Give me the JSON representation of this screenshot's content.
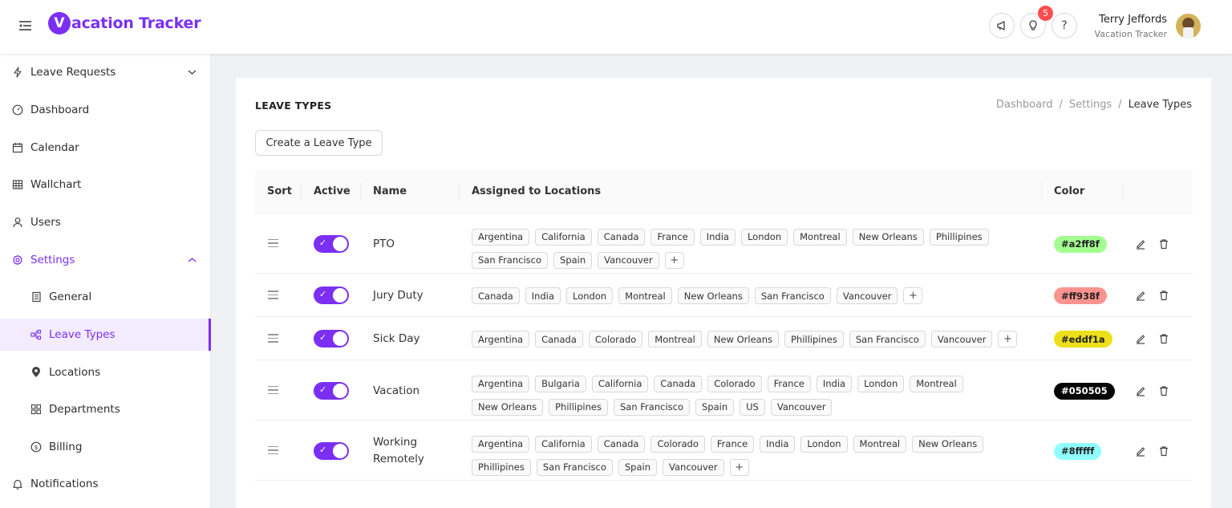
{
  "app": {
    "name": "Vacation Tracker",
    "logo_letter": "V",
    "logo_rest": "acation Tracker",
    "brand_color": "#7b2ff2"
  },
  "header": {
    "notifications_count": "5",
    "user_name": "Terry Jeffords",
    "user_company": "Vacation Tracker",
    "help_icon": "?"
  },
  "sidebar": {
    "items": [
      {
        "label": "Leave Requests",
        "icon": "bolt-icon"
      },
      {
        "label": "Dashboard",
        "icon": "gauge-icon"
      },
      {
        "label": "Calendar",
        "icon": "calendar-icon"
      },
      {
        "label": "Wallchart",
        "icon": "table-icon"
      },
      {
        "label": "Users",
        "icon": "user-icon"
      },
      {
        "label": "Settings",
        "icon": "gear-icon"
      },
      {
        "label": "General",
        "icon": "document-icon"
      },
      {
        "label": "Leave Types",
        "icon": "nodes-icon"
      },
      {
        "label": "Locations",
        "icon": "pin-icon"
      },
      {
        "label": "Departments",
        "icon": "blocks-icon"
      },
      {
        "label": "Billing",
        "icon": "dollar-icon"
      },
      {
        "label": "Notifications",
        "icon": "bell-icon"
      }
    ]
  },
  "page": {
    "title": "LEAVE TYPES",
    "breadcrumb": [
      "Dashboard",
      "/",
      "Settings",
      "/",
      "Leave Types"
    ],
    "create_button": "Create a Leave Type"
  },
  "table": {
    "columns": [
      "Sort",
      "Active",
      "Name",
      "Assigned to Locations",
      "Color"
    ],
    "rows": [
      {
        "name": "PTO",
        "active": true,
        "locations": [
          "Argentina",
          "California",
          "Canada",
          "France",
          "India",
          "London",
          "Montreal",
          "New Orleans",
          "Phillipines",
          "San Francisco",
          "Spain",
          "Vancouver"
        ],
        "color": "#a2ff8f",
        "color_label": "#a2ff8f"
      },
      {
        "name": "Jury Duty",
        "active": true,
        "locations": [
          "Canada",
          "India",
          "London",
          "Montreal",
          "New Orleans",
          "San Francisco",
          "Vancouver"
        ],
        "color": "#ff938f",
        "color_label": "#ff938f"
      },
      {
        "name": "Sick Day",
        "active": true,
        "locations": [
          "Argentina",
          "Canada",
          "Colorado",
          "Montreal",
          "New Orleans",
          "Phillipines",
          "San Francisco",
          "Vancouver"
        ],
        "color": "#eddf1a",
        "color_label": "#eddf1a"
      },
      {
        "name": "Vacation",
        "active": true,
        "locations": [
          "Argentina",
          "Bulgaria",
          "California",
          "Canada",
          "Colorado",
          "France",
          "India",
          "London",
          "Montreal",
          "New Orleans",
          "Phillipines",
          "San Francisco",
          "Spain",
          "US",
          "Vancouver"
        ],
        "color": "#050505",
        "color_label": "#050505"
      },
      {
        "name": "Working Remotely",
        "active": true,
        "locations": [
          "Argentina",
          "California",
          "Canada",
          "Colorado",
          "France",
          "India",
          "London",
          "Montreal",
          "New Orleans",
          "Phillipines",
          "San Francisco",
          "Spain",
          "Vancouver"
        ],
        "color": "#8fffff",
        "color_label": "#8fffff"
      }
    ]
  }
}
